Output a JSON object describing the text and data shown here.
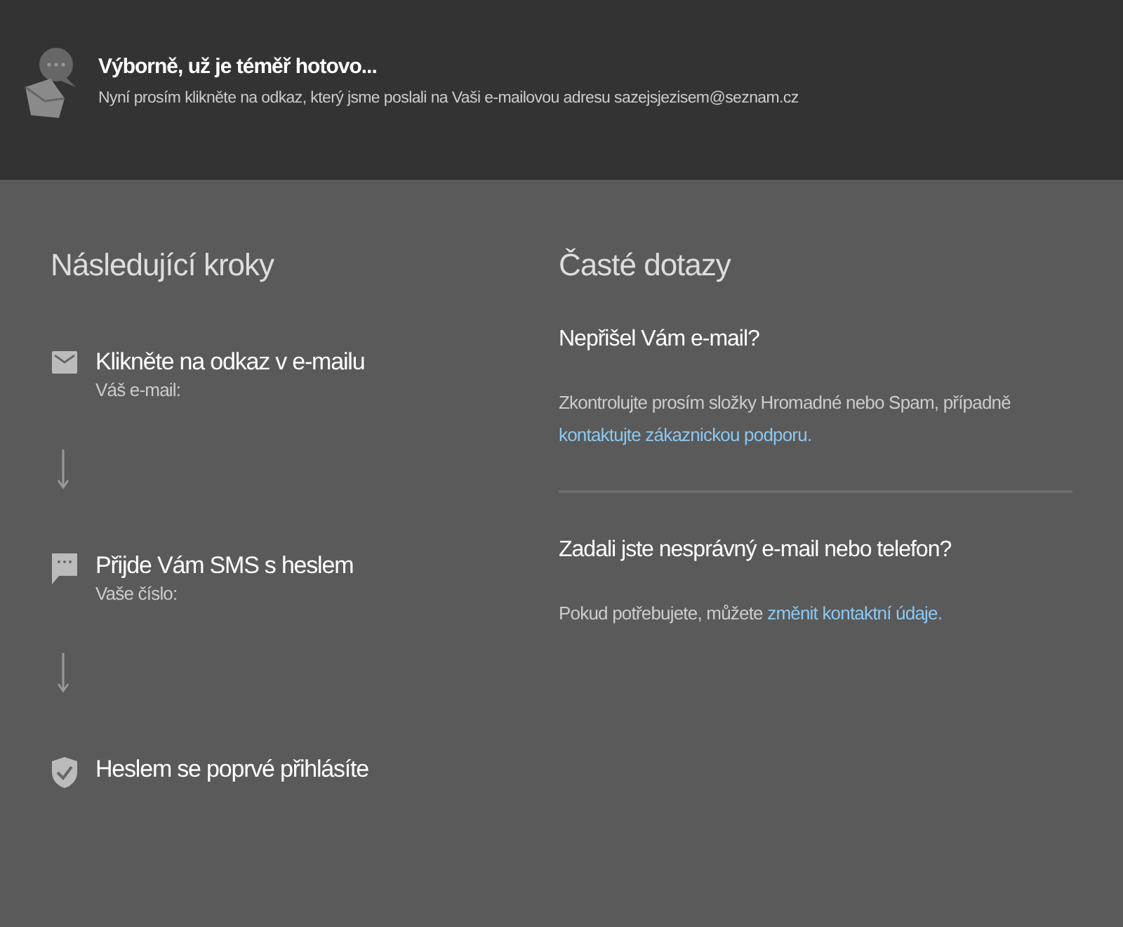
{
  "header": {
    "title": "Výborně, už je téměř hotovo...",
    "subtitle": "Nyní prosím klikněte na odkaz, který jsme poslali na Vaši e-mailovou adresu sazejsjezisem@seznam.cz"
  },
  "steps": {
    "title": "Následující kroky",
    "items": [
      {
        "kind": "mail",
        "title": "Klikněte na odkaz v e-mailu",
        "detail": "Váš e-mail:"
      },
      {
        "kind": "sms",
        "title": "Přijde Vám SMS s heslem",
        "detail": "Vaše číslo:"
      },
      {
        "kind": "shield",
        "title": "Heslem se poprvé přihlásíte"
      }
    ]
  },
  "faq": {
    "title": "Časté dotazy",
    "items": [
      {
        "question": "Nepřišel Vám e-mail?",
        "text": "Zkontrolujte prosím složky Hromadné nebo Spam, případně",
        "link": "kontaktujte zákaznickou podporu."
      },
      {
        "question": "Zadali jste nesprávný e-mail nebo telefon?",
        "text": "Pokud potřebujete, můžete",
        "link": "změnit kontaktní údaje."
      }
    ]
  }
}
